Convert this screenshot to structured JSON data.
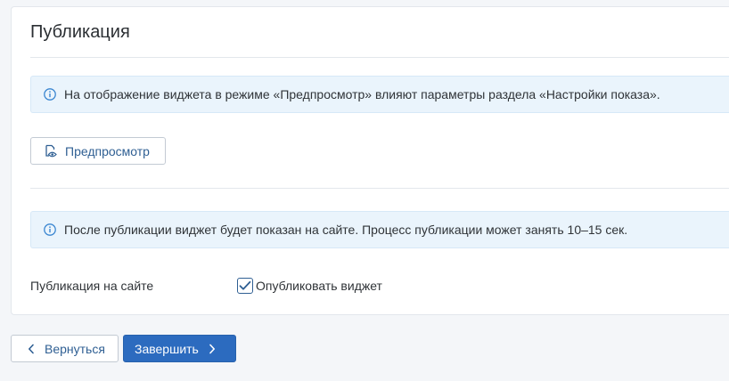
{
  "publication": {
    "title": "Публикация",
    "preview_info": "На отображение виджета в режиме «Предпросмотр» влияют параметры раздела «Настройки показа».",
    "preview_button": "Предпросмотр",
    "publish_info": "После публикации виджет будет показан на сайте. Процесс публикации может занять 10–15 сек.",
    "site_label": "Публикация на сайте",
    "publish_checkbox_label": "Опубликовать виджет",
    "publish_checked": true
  },
  "footer": {
    "back_button": "Вернуться",
    "finish_button": "Завершить"
  },
  "colors": {
    "accent": "#2c6bbf",
    "info_bg": "#eaf4fc",
    "link": "#2f5f93",
    "page_bg": "#f4f6f9"
  },
  "icons": {
    "info": "info-circle-icon",
    "preview": "preview-eye-icon",
    "back": "chevron-left-icon",
    "finish": "chevron-right-icon",
    "check": "check-icon"
  }
}
